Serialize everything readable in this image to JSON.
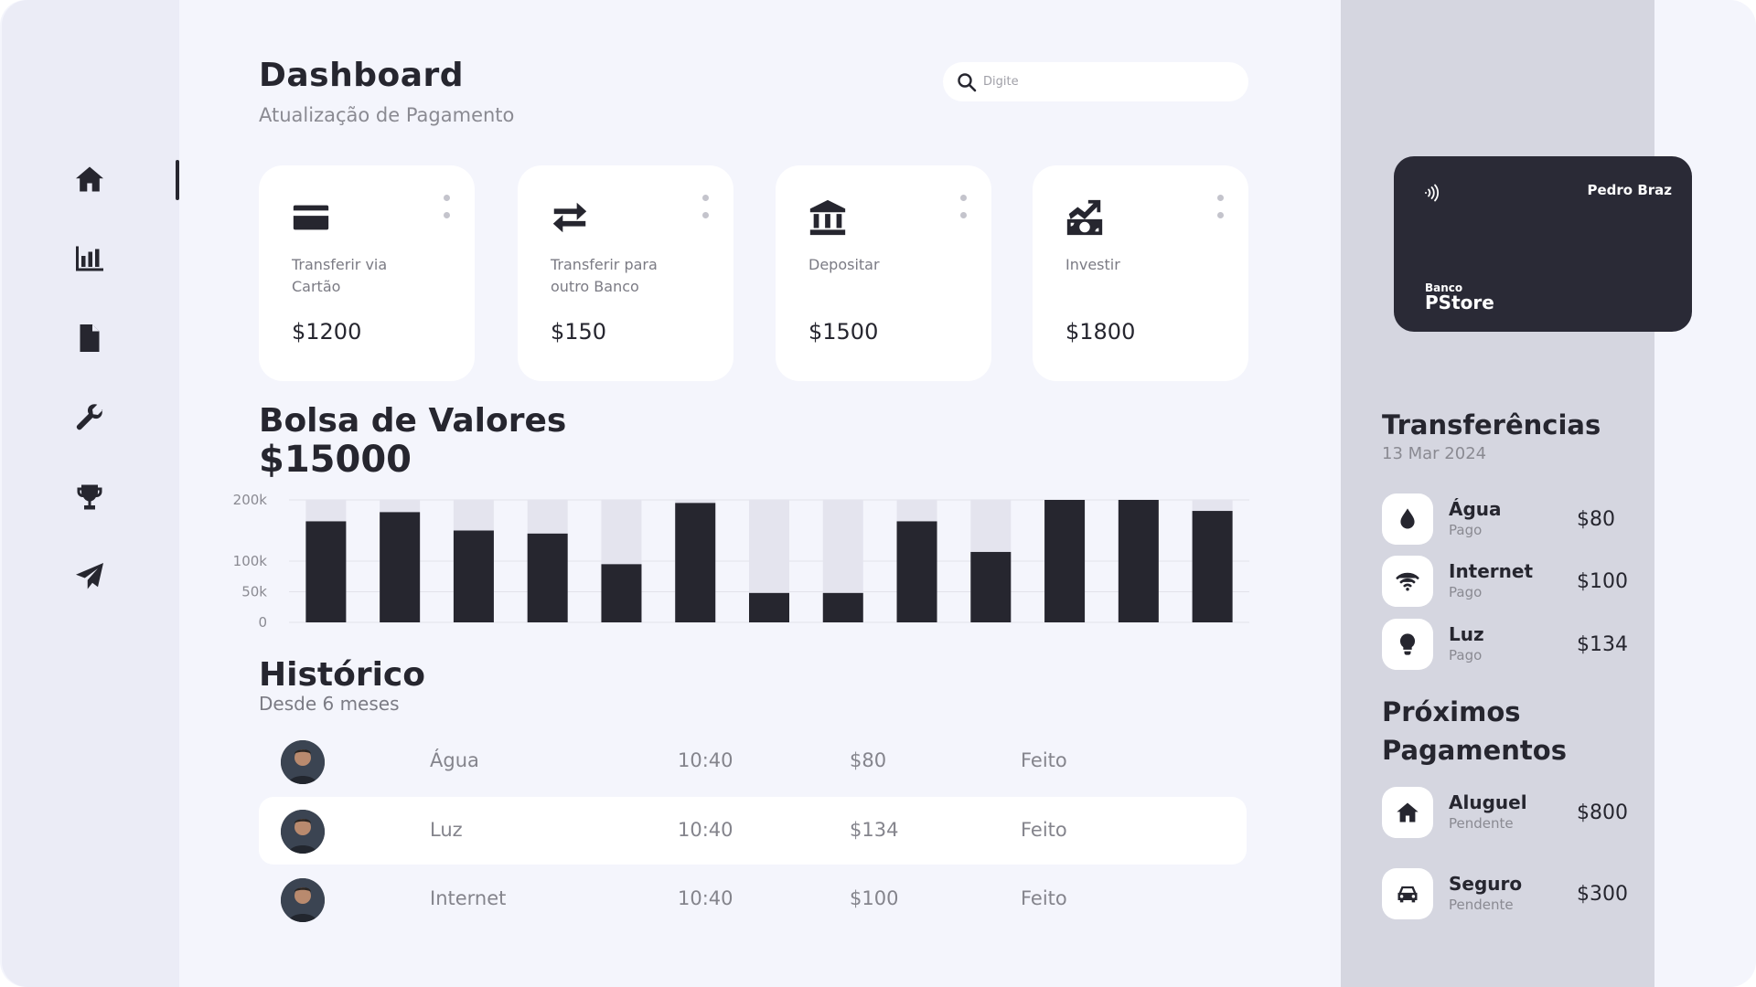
{
  "header": {
    "title": "Dashboard",
    "subtitle": "Atualização de Pagamento",
    "search_placeholder": "Digite"
  },
  "sidebar": {
    "items": [
      {
        "name": "home",
        "icon": "home-icon",
        "active": true
      },
      {
        "name": "stats",
        "icon": "bar-chart-icon",
        "active": false
      },
      {
        "name": "documents",
        "icon": "document-icon",
        "active": false
      },
      {
        "name": "settings",
        "icon": "wrench-icon",
        "active": false
      },
      {
        "name": "rewards",
        "icon": "trophy-icon",
        "active": false
      },
      {
        "name": "send",
        "icon": "paper-plane-icon",
        "active": false
      }
    ]
  },
  "cards": [
    {
      "icon": "credit-card-icon",
      "label": "Transferir via Cartão",
      "value": "$1200"
    },
    {
      "icon": "arrows-exchange-icon",
      "label": "Transferir para outro Banco",
      "value": "$150"
    },
    {
      "icon": "bank-icon",
      "label": "Depositar",
      "value": "$1500"
    },
    {
      "icon": "invest-icon",
      "label": "Investir",
      "value": "$1800"
    }
  ],
  "chart": {
    "title": "Bolsa de Valores",
    "total": "$15000"
  },
  "chart_data": {
    "type": "bar",
    "categories": [
      "",
      "",
      "",
      "",
      "",
      "",
      "",
      "",
      "",
      "",
      "",
      "",
      ""
    ],
    "series": [
      {
        "values": [
          165,
          180,
          150,
          145,
          95,
          195,
          48,
          48,
          165,
          115,
          200,
          200,
          182
        ]
      }
    ],
    "ylim": [
      0,
      200
    ],
    "yticks": [
      0,
      50,
      100,
      200
    ],
    "ytick_labels": [
      "0",
      "50k",
      "100k",
      "200k"
    ],
    "grid": true,
    "colors": {
      "bar": "#26262f",
      "track": "#e4e4ee"
    }
  },
  "history": {
    "title": "Histórico",
    "subtitle": "Desde 6 meses",
    "rows": [
      {
        "name": "Água",
        "time": "10:40",
        "amount": "$80",
        "status": "Feito"
      },
      {
        "name": "Luz",
        "time": "10:40",
        "amount": "$134",
        "status": "Feito"
      },
      {
        "name": "Internet",
        "time": "10:40",
        "amount": "$100",
        "status": "Feito"
      }
    ]
  },
  "bank_card": {
    "holder": "Pedro Braz",
    "bank_prefix": "Banco",
    "bank_name": "PStore"
  },
  "transfers": {
    "title": "Transferências",
    "date": "13 Mar 2024",
    "items": [
      {
        "icon": "water-drop-icon",
        "name": "Água",
        "status": "Pago",
        "amount": "$80"
      },
      {
        "icon": "wifi-icon",
        "name": "Internet",
        "status": "Pago",
        "amount": "$100"
      },
      {
        "icon": "lightbulb-icon",
        "name": "Luz",
        "status": "Pago",
        "amount": "$134"
      }
    ]
  },
  "upcoming": {
    "title_line1": "Próximos",
    "title_line2": "Pagamentos",
    "items": [
      {
        "icon": "house-icon",
        "name": "Aluguel",
        "status": "Pendente",
        "amount": "$800"
      },
      {
        "icon": "car-icon",
        "name": "Seguro",
        "status": "Pendente",
        "amount": "$300"
      }
    ]
  },
  "colors": {
    "background": "#f4f5fc",
    "sidebar": "#ebecf6",
    "right_panel": "#d5d6e0",
    "dark": "#26262f",
    "card": "#2a2a36"
  }
}
